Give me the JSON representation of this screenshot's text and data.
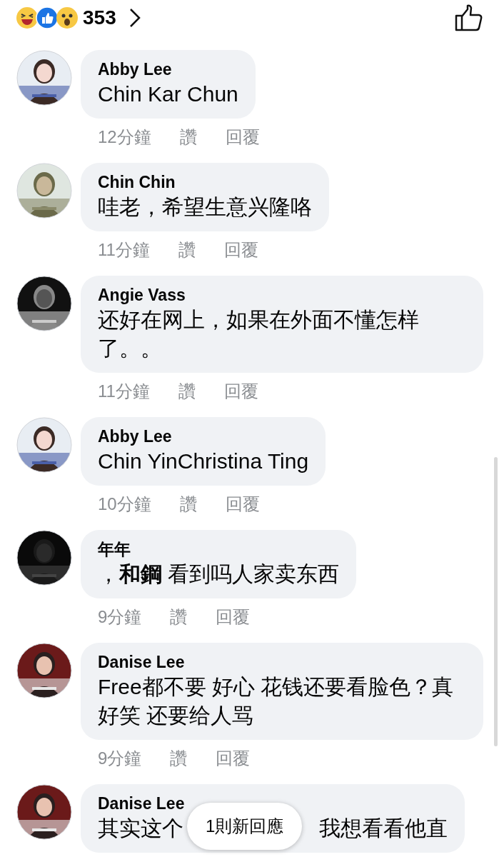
{
  "reactions": {
    "count": "353"
  },
  "comments": [
    {
      "name": "Abby Lee",
      "text": "Chin Kar Chun",
      "time": "12分鐘",
      "like": "讚",
      "reply": "回覆"
    },
    {
      "name": "Chin Chin",
      "text": "哇老，希望生意兴隆咯",
      "time": "11分鐘",
      "like": "讚",
      "reply": "回覆"
    },
    {
      "name": "Angie Vass",
      "text": "还好在网上，如果在外面不懂怎样了。。",
      "time": "11分鐘",
      "like": "讚",
      "reply": "回覆"
    },
    {
      "name": "Abby Lee",
      "text": "Chin YinChristina Ting",
      "time": "10分鐘",
      "like": "讚",
      "reply": "回覆"
    },
    {
      "name": "年年",
      "text": "，**和鋼** 看到吗人家卖东西",
      "time": "9分鐘",
      "like": "讚",
      "reply": "回覆"
    },
    {
      "name": "Danise Lee",
      "text": "Free都不要 好心  花钱还要看脸色？真好笑  还要给人骂",
      "time": "9分鐘",
      "like": "讚",
      "reply": "回覆"
    },
    {
      "name": "Danise Lee",
      "text": "其实这个",
      "text_after": "我想看看他直"
    }
  ],
  "new_replies": {
    "label": "1則新回應"
  }
}
